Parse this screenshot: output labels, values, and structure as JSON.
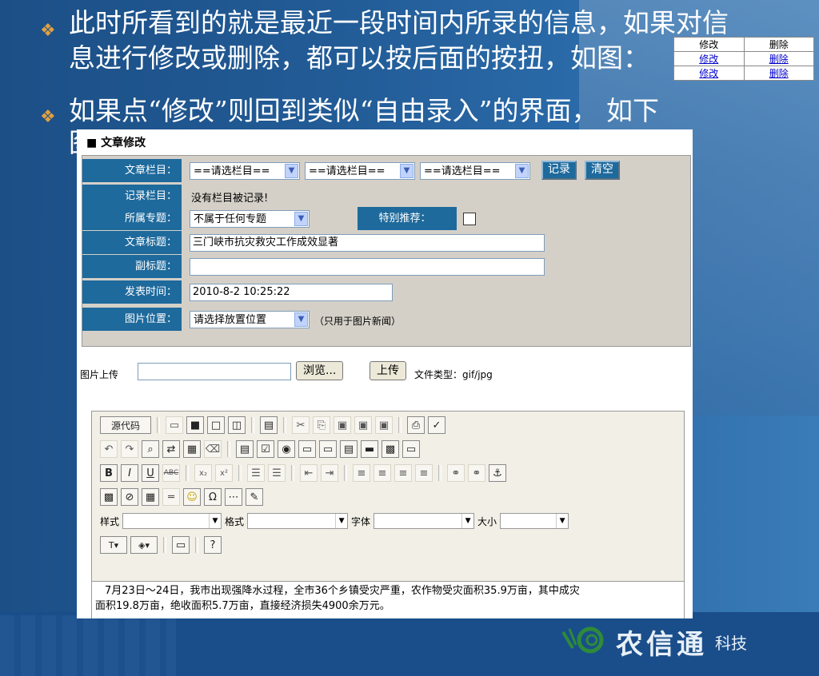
{
  "slide": {
    "line1": "此时所看到的就是最近一段时间内所录的信息，如果对信",
    "line2": "息进行修改或删除，都可以按后面的按扭，如图：",
    "line3": "如果点“修改”则回到类似“自由录入”的界面， 如下",
    "line4": "图"
  },
  "mini_table": {
    "header": [
      "修改",
      "删除"
    ],
    "rows": [
      [
        "修改",
        "删除"
      ],
      [
        "修改",
        "删除"
      ]
    ]
  },
  "form": {
    "title": "■ 文章修改",
    "column_label": "文章栏目：",
    "select_placeholder": "==请选栏目==",
    "record_btn": "记录",
    "clear_btn": "清空",
    "recorded_label": "记录栏目：",
    "recorded_value": "没有栏目被记录!",
    "topic_label": "所属专题：",
    "topic_value": "不属于任何专题",
    "featured_label": "特别推荐：",
    "title_label": "文章标题：",
    "title_value": "三门峡市抗灾救灾工作成效显著",
    "subtitle_label": "副标题：",
    "subtitle_value": "",
    "time_label": "发表时间：",
    "time_value": "2010-8-2 10:25:22",
    "image_pos_label": "图片位置：",
    "image_pos_value": "请选择放置位置",
    "image_pos_note": "（只用于图片新闻）"
  },
  "upload": {
    "label": "图片上传",
    "browse": "浏览...",
    "upload_btn": "上传",
    "file_types": "文件类型：gif/jpg"
  },
  "editor": {
    "source_btn": "源代码",
    "style_label": "样式",
    "format_label": "格式",
    "font_label": "字体",
    "size_label": "大小",
    "content_line1": "7月23日～24日，我市出现强降水过程，全市36个乡镇受灾严重，农作物受灾面积35.9万亩，其中成灾",
    "content_line2": "面积19.8万亩，绝收面积5.7万亩，直接经济损失4900余万元。"
  },
  "logo": {
    "text": "农信通",
    "suffix": "科技"
  }
}
